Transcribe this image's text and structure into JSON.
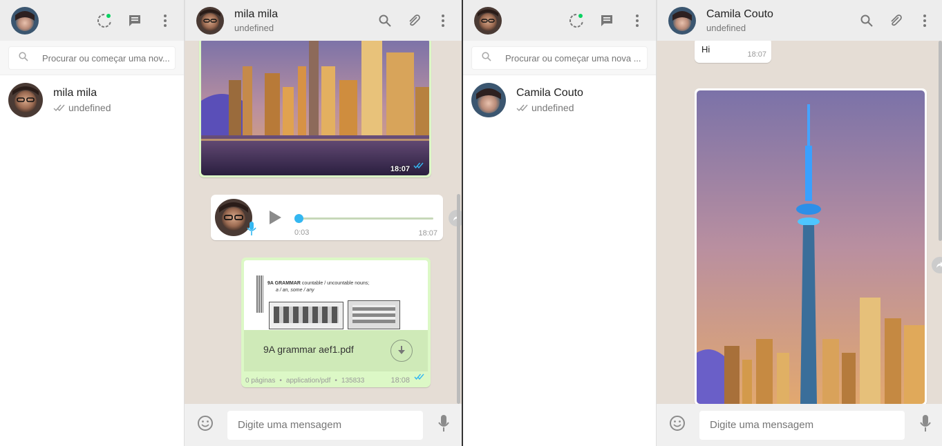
{
  "left": {
    "search": {
      "placeholder": "Procurar ou começar uma nov..."
    },
    "chats": [
      {
        "name": "mila mila",
        "status": "undefined"
      }
    ],
    "header": {
      "name": "mila mila",
      "status": "undefined"
    },
    "messages": {
      "image": {
        "time": "18:07"
      },
      "audio": {
        "elapsed": "0:03",
        "time": "18:07",
        "progress": 0
      },
      "document": {
        "filename": "9A grammar aef1.pdf",
        "pages": "0 páginas",
        "mime": "application/pdf",
        "size": "135833",
        "time": "18:08",
        "preview_heading": "9A GRAMMAR",
        "preview_line1": "countable / uncountable nouns;",
        "preview_line2": "a / an, some / any"
      }
    },
    "composer": {
      "placeholder": "Digite uma mensagem"
    }
  },
  "right": {
    "search": {
      "placeholder": "Procurar ou começar uma nova ..."
    },
    "chats": [
      {
        "name": "Camila Couto",
        "status": "undefined"
      }
    ],
    "header": {
      "name": "Camila Couto",
      "status": "undefined"
    },
    "messages": {
      "text": {
        "body": "Hi",
        "time": "18:07"
      }
    },
    "composer": {
      "placeholder": "Digite uma mensagem"
    }
  },
  "colors": {
    "accent": "#34b7f1",
    "status_dot": "#09d261",
    "chat_bg": "#e5ddd5",
    "outgoing": "#dcf8c6",
    "header": "#ededed"
  },
  "icons": [
    "status-icon",
    "new-chat-icon",
    "menu-icon",
    "search-icon",
    "attach-icon",
    "emoji-icon",
    "mic-icon",
    "play-icon",
    "download-icon",
    "double-check-icon",
    "share-icon"
  ]
}
